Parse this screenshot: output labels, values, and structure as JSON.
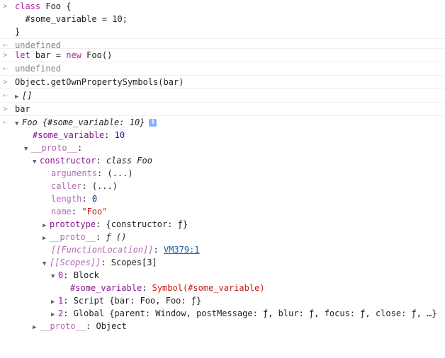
{
  "icons": {
    "input_prompt": "chevron-right-icon",
    "output_return": "return-arrow-icon",
    "collapsed": "triangle-right-icon",
    "expanded": "triangle-down-icon",
    "info": "info-icon"
  },
  "entries": [
    {
      "input": [
        "class Foo {",
        "  #some_variable = 10;",
        "}"
      ],
      "output": "undefined"
    },
    {
      "input": [
        "let bar = new Foo()"
      ],
      "output": "undefined"
    },
    {
      "input": [
        "Object.getOwnPropertySymbols(bar)"
      ],
      "output": "[]"
    },
    {
      "input": [
        "bar"
      ]
    }
  ],
  "tree": {
    "root_label": "Foo {#some_variable: 10}",
    "info_label": "i",
    "own_field": {
      "key": "#some_variable",
      "value": "10"
    },
    "proto_key": "__proto__",
    "constructor": {
      "key": "constructor",
      "value": "class Foo"
    },
    "props": [
      {
        "key": "arguments",
        "value": "(...)"
      },
      {
        "key": "caller",
        "value": "(...)"
      },
      {
        "key": "length",
        "value": "0"
      },
      {
        "key": "name",
        "value": "\"Foo\""
      }
    ],
    "prototype": {
      "key": "prototype",
      "value": "{constructor: ƒ}"
    },
    "inner_proto": {
      "key": "__proto__",
      "value": "ƒ ()"
    },
    "function_location": {
      "key": "[[FunctionLocation]]",
      "value": "VM379:1"
    },
    "scopes": {
      "key": "[[Scopes]]",
      "value": "Scopes[3]"
    },
    "scope0": {
      "key": "0",
      "value": "Block"
    },
    "scope0_field": {
      "key": "#some_variable",
      "value": "Symbol(#some_variable)"
    },
    "scope1": {
      "key": "1",
      "value": "Script {bar: Foo, Foo: ƒ}"
    },
    "scope2": {
      "key": "2",
      "value": "Global {parent: Window, postMessage: ƒ, blur: ƒ, focus: ƒ, close: ƒ, …}"
    },
    "outer_proto": {
      "key": "__proto__",
      "value": "Object"
    }
  }
}
